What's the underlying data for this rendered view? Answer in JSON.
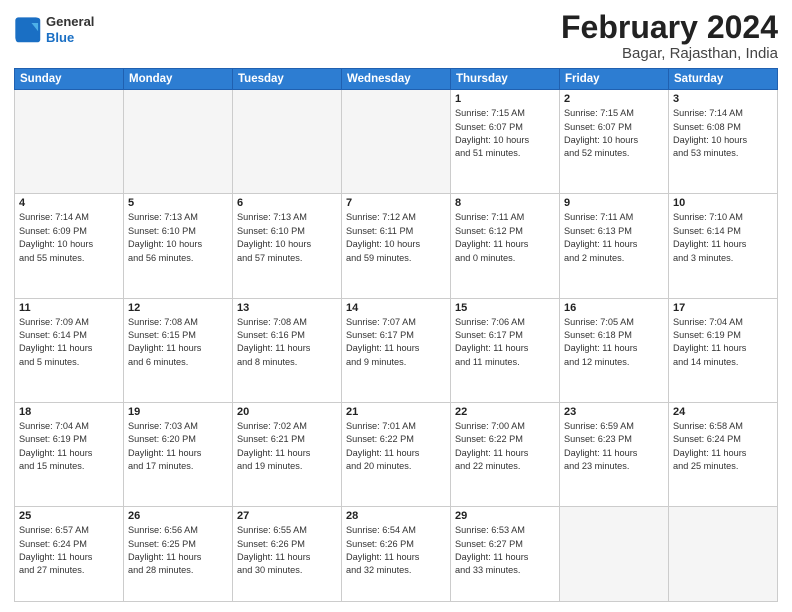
{
  "header": {
    "logo_general": "General",
    "logo_blue": "Blue",
    "month_title": "February 2024",
    "location": "Bagar, Rajasthan, India"
  },
  "weekdays": [
    "Sunday",
    "Monday",
    "Tuesday",
    "Wednesday",
    "Thursday",
    "Friday",
    "Saturday"
  ],
  "weeks": [
    [
      {
        "day": "",
        "info": ""
      },
      {
        "day": "",
        "info": ""
      },
      {
        "day": "",
        "info": ""
      },
      {
        "day": "",
        "info": ""
      },
      {
        "day": "1",
        "info": "Sunrise: 7:15 AM\nSunset: 6:07 PM\nDaylight: 10 hours\nand 51 minutes."
      },
      {
        "day": "2",
        "info": "Sunrise: 7:15 AM\nSunset: 6:07 PM\nDaylight: 10 hours\nand 52 minutes."
      },
      {
        "day": "3",
        "info": "Sunrise: 7:14 AM\nSunset: 6:08 PM\nDaylight: 10 hours\nand 53 minutes."
      }
    ],
    [
      {
        "day": "4",
        "info": "Sunrise: 7:14 AM\nSunset: 6:09 PM\nDaylight: 10 hours\nand 55 minutes."
      },
      {
        "day": "5",
        "info": "Sunrise: 7:13 AM\nSunset: 6:10 PM\nDaylight: 10 hours\nand 56 minutes."
      },
      {
        "day": "6",
        "info": "Sunrise: 7:13 AM\nSunset: 6:10 PM\nDaylight: 10 hours\nand 57 minutes."
      },
      {
        "day": "7",
        "info": "Sunrise: 7:12 AM\nSunset: 6:11 PM\nDaylight: 10 hours\nand 59 minutes."
      },
      {
        "day": "8",
        "info": "Sunrise: 7:11 AM\nSunset: 6:12 PM\nDaylight: 11 hours\nand 0 minutes."
      },
      {
        "day": "9",
        "info": "Sunrise: 7:11 AM\nSunset: 6:13 PM\nDaylight: 11 hours\nand 2 minutes."
      },
      {
        "day": "10",
        "info": "Sunrise: 7:10 AM\nSunset: 6:14 PM\nDaylight: 11 hours\nand 3 minutes."
      }
    ],
    [
      {
        "day": "11",
        "info": "Sunrise: 7:09 AM\nSunset: 6:14 PM\nDaylight: 11 hours\nand 5 minutes."
      },
      {
        "day": "12",
        "info": "Sunrise: 7:08 AM\nSunset: 6:15 PM\nDaylight: 11 hours\nand 6 minutes."
      },
      {
        "day": "13",
        "info": "Sunrise: 7:08 AM\nSunset: 6:16 PM\nDaylight: 11 hours\nand 8 minutes."
      },
      {
        "day": "14",
        "info": "Sunrise: 7:07 AM\nSunset: 6:17 PM\nDaylight: 11 hours\nand 9 minutes."
      },
      {
        "day": "15",
        "info": "Sunrise: 7:06 AM\nSunset: 6:17 PM\nDaylight: 11 hours\nand 11 minutes."
      },
      {
        "day": "16",
        "info": "Sunrise: 7:05 AM\nSunset: 6:18 PM\nDaylight: 11 hours\nand 12 minutes."
      },
      {
        "day": "17",
        "info": "Sunrise: 7:04 AM\nSunset: 6:19 PM\nDaylight: 11 hours\nand 14 minutes."
      }
    ],
    [
      {
        "day": "18",
        "info": "Sunrise: 7:04 AM\nSunset: 6:19 PM\nDaylight: 11 hours\nand 15 minutes."
      },
      {
        "day": "19",
        "info": "Sunrise: 7:03 AM\nSunset: 6:20 PM\nDaylight: 11 hours\nand 17 minutes."
      },
      {
        "day": "20",
        "info": "Sunrise: 7:02 AM\nSunset: 6:21 PM\nDaylight: 11 hours\nand 19 minutes."
      },
      {
        "day": "21",
        "info": "Sunrise: 7:01 AM\nSunset: 6:22 PM\nDaylight: 11 hours\nand 20 minutes."
      },
      {
        "day": "22",
        "info": "Sunrise: 7:00 AM\nSunset: 6:22 PM\nDaylight: 11 hours\nand 22 minutes."
      },
      {
        "day": "23",
        "info": "Sunrise: 6:59 AM\nSunset: 6:23 PM\nDaylight: 11 hours\nand 23 minutes."
      },
      {
        "day": "24",
        "info": "Sunrise: 6:58 AM\nSunset: 6:24 PM\nDaylight: 11 hours\nand 25 minutes."
      }
    ],
    [
      {
        "day": "25",
        "info": "Sunrise: 6:57 AM\nSunset: 6:24 PM\nDaylight: 11 hours\nand 27 minutes."
      },
      {
        "day": "26",
        "info": "Sunrise: 6:56 AM\nSunset: 6:25 PM\nDaylight: 11 hours\nand 28 minutes."
      },
      {
        "day": "27",
        "info": "Sunrise: 6:55 AM\nSunset: 6:26 PM\nDaylight: 11 hours\nand 30 minutes."
      },
      {
        "day": "28",
        "info": "Sunrise: 6:54 AM\nSunset: 6:26 PM\nDaylight: 11 hours\nand 32 minutes."
      },
      {
        "day": "29",
        "info": "Sunrise: 6:53 AM\nSunset: 6:27 PM\nDaylight: 11 hours\nand 33 minutes."
      },
      {
        "day": "",
        "info": ""
      },
      {
        "day": "",
        "info": ""
      }
    ]
  ]
}
